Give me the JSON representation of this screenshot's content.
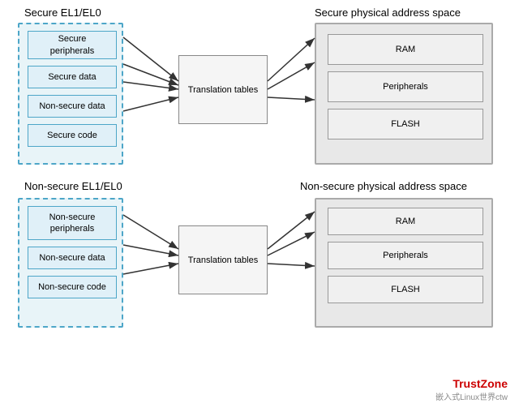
{
  "labels": {
    "secure_el": "Secure EL1/EL0",
    "nonsecure_el": "Non-secure EL1/EL0",
    "secure_phys": "Secure physical address space",
    "nonsecure_phys": "Non-secure physical address space"
  },
  "top_sources": [
    {
      "id": "secure-peripherals",
      "text": "Secure\nperipherals"
    },
    {
      "id": "secure-data",
      "text": "Secure data"
    },
    {
      "id": "nonsecure-data-top",
      "text": "Non-secure data"
    },
    {
      "id": "secure-code",
      "text": "Secure code"
    }
  ],
  "bottom_sources": [
    {
      "id": "nonsecure-peripherals",
      "text": "Non-secure\nperipherals"
    },
    {
      "id": "nonsecure-data-bottom",
      "text": "Non-secure data"
    },
    {
      "id": "nonsecure-code",
      "text": "Non-secure code"
    }
  ],
  "translation_top": "Translation tables",
  "translation_bottom": "Translation tables",
  "top_destinations": [
    {
      "id": "ram-top",
      "text": "RAM"
    },
    {
      "id": "peripherals-top",
      "text": "Peripherals"
    },
    {
      "id": "flash-top",
      "text": "FLASH"
    }
  ],
  "bottom_destinations": [
    {
      "id": "ram-bottom",
      "text": "RAM"
    },
    {
      "id": "peripherals-bottom",
      "text": "Peripherals"
    },
    {
      "id": "flash-bottom",
      "text": "FLASH"
    }
  ],
  "watermark_brand": "TrustZone",
  "watermark_site": "嵌入式Linux世界ctw"
}
